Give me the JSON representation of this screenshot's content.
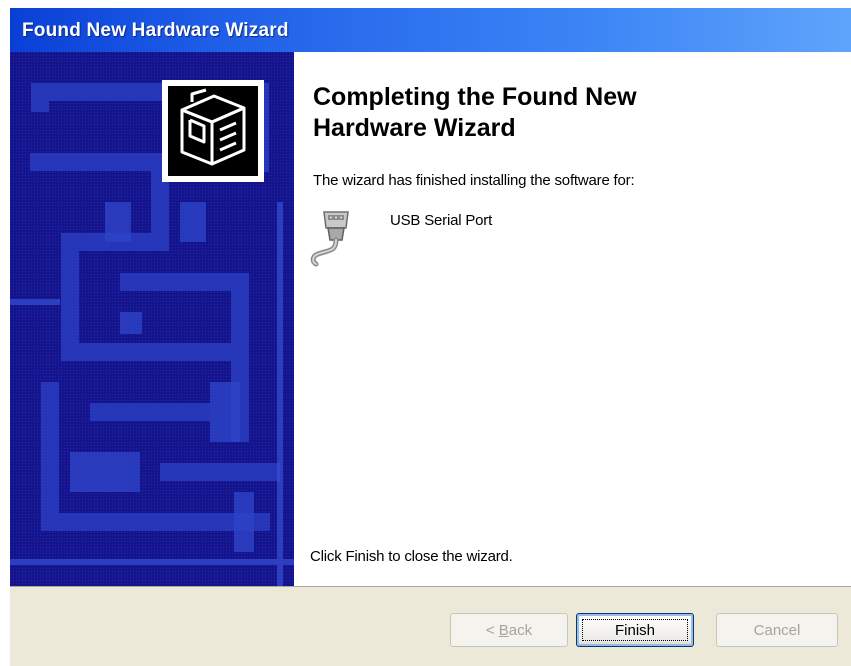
{
  "window": {
    "title": "Found New Hardware Wizard"
  },
  "content": {
    "heading": "Completing the Found New Hardware Wizard",
    "intro": "The wizard has finished installing the software for:",
    "device_name": "USB Serial Port",
    "close_hint": "Click Finish to close the wizard."
  },
  "buttons": {
    "back_prefix": "< ",
    "back_accel": "B",
    "back_rest": "ack",
    "finish": "Finish",
    "cancel": "Cancel"
  },
  "icons": {
    "wizard": "hardware-box-icon",
    "device": "serial-port-cable-icon"
  },
  "colors": {
    "titlebar": "#0a3fd6",
    "side_panel": "#14148c",
    "button_bar": "#ece9d8"
  },
  "state": {
    "back_enabled": false,
    "finish_enabled": true,
    "cancel_enabled": false
  }
}
